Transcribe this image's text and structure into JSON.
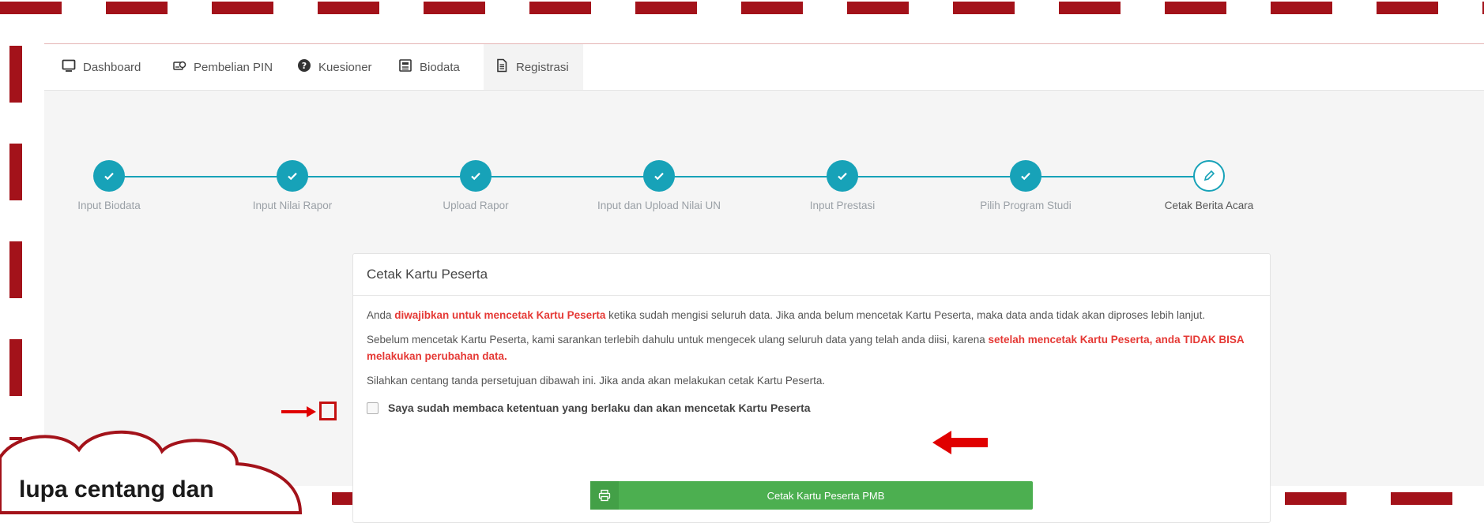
{
  "nav": {
    "items": [
      {
        "label": "Dashboard",
        "icon": "monitor-icon"
      },
      {
        "label": "Pembelian PIN",
        "icon": "money-icon"
      },
      {
        "label": "Kuesioner",
        "icon": "question-icon"
      },
      {
        "label": "Biodata",
        "icon": "id-card-icon"
      },
      {
        "label": "Registrasi",
        "icon": "document-icon"
      }
    ]
  },
  "steps": [
    {
      "label": "Input Biodata",
      "status": "done"
    },
    {
      "label": "Input Nilai Rapor",
      "status": "done"
    },
    {
      "label": "Upload Rapor",
      "status": "done"
    },
    {
      "label": "Input dan Upload Nilai UN",
      "status": "done"
    },
    {
      "label": "Input Prestasi",
      "status": "done"
    },
    {
      "label": "Pilih Program Studi",
      "status": "done"
    },
    {
      "label": "Cetak Berita Acara",
      "status": "current"
    }
  ],
  "card": {
    "title": "Cetak Kartu Peserta",
    "p1_a": "Anda ",
    "p1_red": "diwajibkan untuk mencetak Kartu Peserta",
    "p1_b": " ketika sudah mengisi seluruh data. Jika anda belum mencetak Kartu Peserta, maka data anda tidak akan diproses lebih lanjut.",
    "p2_a": "Sebelum mencetak Kartu Peserta, kami sarankan terlebih dahulu untuk mengecek ulang seluruh data yang telah anda diisi, karena ",
    "p2_red": "setelah mencetak Kartu Peserta, anda TIDAK BISA melakukan perubahan data.",
    "p3": "Silahkan centang tanda persetujuan dibawah ini. Jika anda akan melakukan cetak Kartu Peserta.",
    "checkbox_label": "Saya sudah membaca ketentuan yang berlaku dan akan mencetak Kartu Peserta",
    "button_label": "Cetak Kartu Peserta PMB"
  },
  "annotation": {
    "callout_text": "lupa centang dan",
    "color": "#a3121a"
  },
  "colors": {
    "accent": "#17a2b8",
    "button": "#4caf50",
    "warning_red": "#e53935"
  }
}
